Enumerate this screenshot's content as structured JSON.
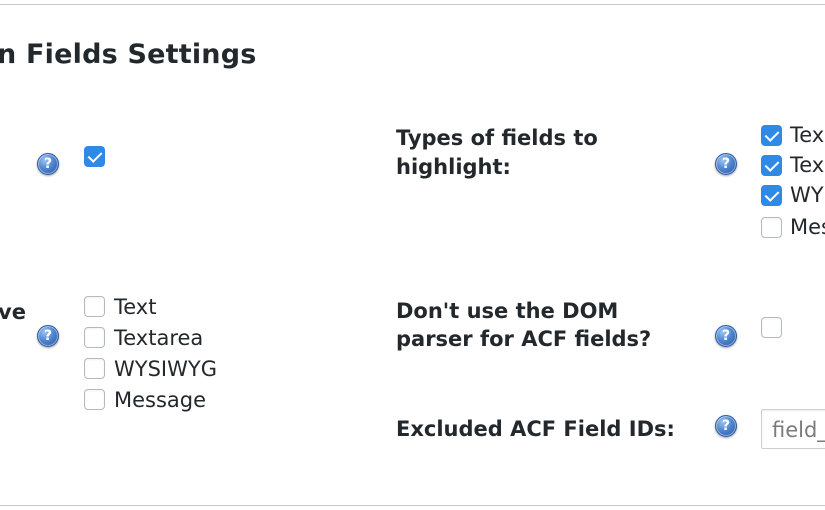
{
  "section": {
    "title": "n Fields Settings"
  },
  "left": {
    "row2_label": "ve",
    "row2_options": [
      {
        "label": "Text",
        "checked": false
      },
      {
        "label": "Textarea",
        "checked": false
      },
      {
        "label": "WYSIWYG",
        "checked": false
      },
      {
        "label": "Message",
        "checked": false
      }
    ]
  },
  "right": {
    "types_label_line1": "Types of fields to",
    "types_label_line2": "highlight:",
    "types_options": [
      {
        "label": "Tex",
        "checked": true
      },
      {
        "label": "Tex",
        "checked": true
      },
      {
        "label": "WY",
        "checked": true
      },
      {
        "label": "Mes",
        "checked": false
      }
    ],
    "dom_label_line1": "Don't use the DOM",
    "dom_label_line2": "parser for ACF fields?",
    "excluded_label": "Excluded ACF Field IDs:",
    "excluded_value": "field_"
  },
  "help_glyph": "?",
  "colors": {
    "checkbox_checked": "#2f8ae6",
    "help_icon": "#4f86cf",
    "text": "#23282d"
  }
}
